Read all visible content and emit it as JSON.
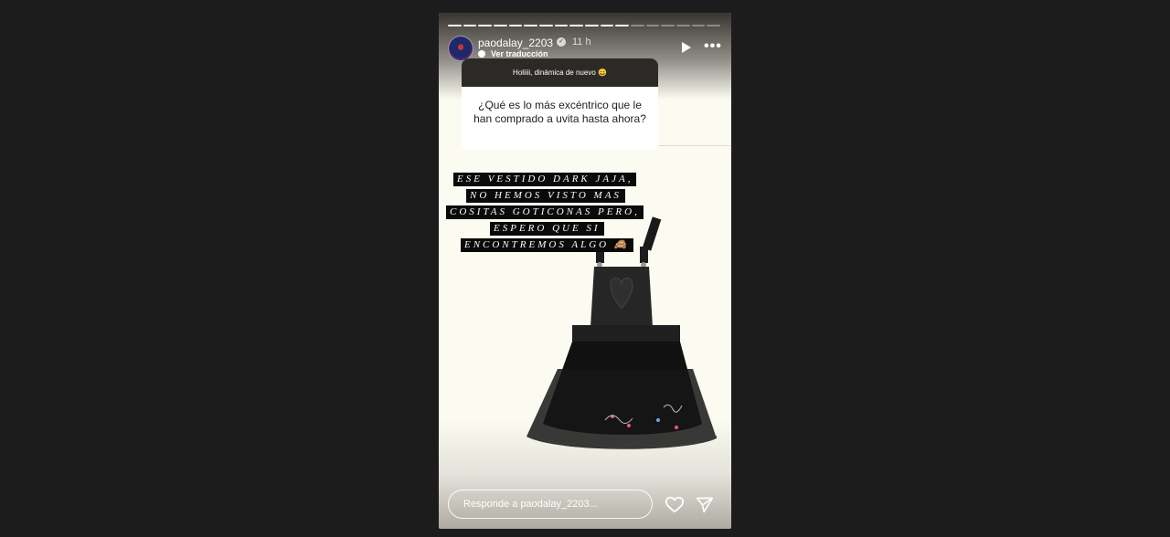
{
  "story": {
    "progress": {
      "total_segments": 18,
      "completed_segments": 12
    },
    "header": {
      "username": "paodalay_2203",
      "verified_icon": "verified-check-icon",
      "time": "11 h",
      "translate_label": "Ver traducción",
      "play_icon": "play-icon",
      "more_icon": "more-options-icon"
    },
    "question_sticker": {
      "prompt": "Holiiii, dinámica de nuevo 😄",
      "question": "¿Qué es lo más excéntrico que le han comprado a uvita hasta ahora?"
    },
    "answer_lines": [
      "ESE VESTIDO DARK JAJA,",
      "NO HEMOS VISTO MAS",
      "COSITAS GOTICONAS PERO,",
      "ESPERO QUE SI",
      "ENCONTREMOS ALGO 🙈"
    ],
    "footer": {
      "reply_placeholder": "Responde a paodalay_2203...",
      "like_icon": "heart-icon",
      "share_icon": "send-icon"
    }
  },
  "colors": {
    "page_background": "#1c1c1c",
    "story_background": "#fbfbf2",
    "sticker_header": "#2c2a27",
    "answer_highlight": "#0a0a0a"
  }
}
